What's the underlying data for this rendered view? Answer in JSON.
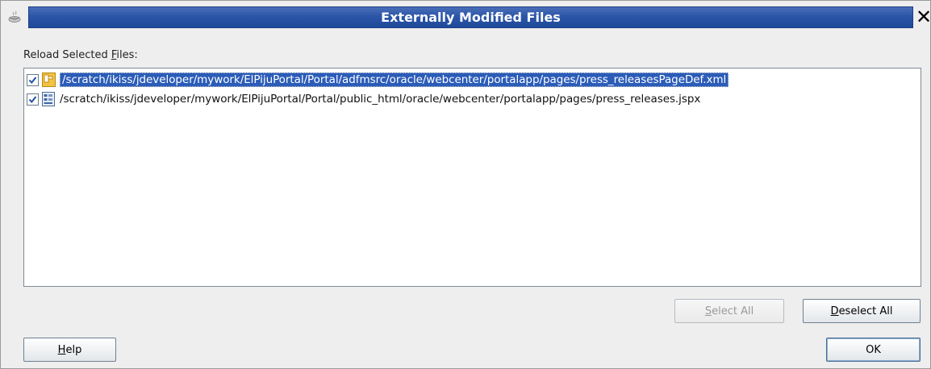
{
  "window": {
    "title": "Externally Modified Files"
  },
  "label": {
    "prefix": "Reload Selected ",
    "mnemonic": "F",
    "suffix": "iles:"
  },
  "files": [
    {
      "path": "/scratch/ikiss/jdeveloper/mywork/ElPijuPortal/Portal/adfmsrc/oracle/webcenter/portalapp/pages/press_releasesPageDef.xml",
      "checked": true,
      "selected": true,
      "icon": "xml-file-icon"
    },
    {
      "path": "/scratch/ikiss/jdeveloper/mywork/ElPijuPortal/Portal/public_html/oracle/webcenter/portalapp/pages/press_releases.jspx",
      "checked": true,
      "selected": false,
      "icon": "jspx-file-icon"
    }
  ],
  "buttons": {
    "select_all": {
      "mnemonic": "S",
      "rest": "elect All",
      "enabled": false
    },
    "deselect_all": {
      "mnemonic": "D",
      "rest": "eselect All",
      "enabled": true
    },
    "help": {
      "mnemonic": "H",
      "rest": "elp"
    },
    "ok": {
      "label": "OK"
    }
  },
  "colors": {
    "title_bar": "#2b55a8",
    "selection": "#2b5cb8"
  }
}
